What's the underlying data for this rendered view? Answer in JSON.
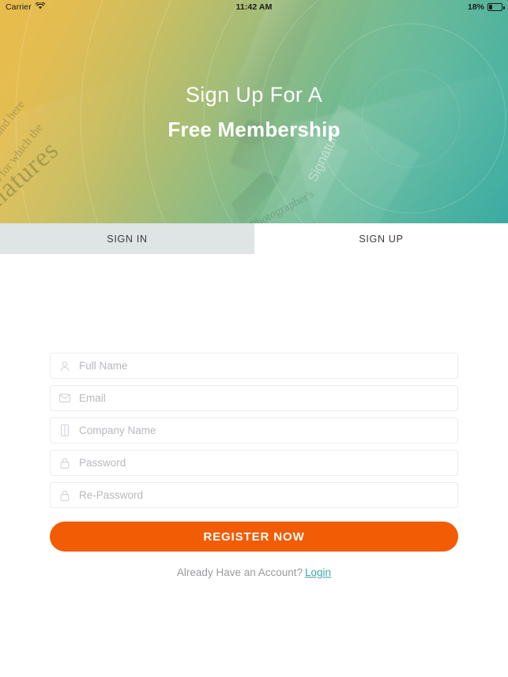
{
  "status_bar": {
    "carrier": "Carrier",
    "wifi_icon": "wifi-icon",
    "time": "11:42 AM",
    "battery_percent": "18%",
    "battery_icon": "battery-low-icon"
  },
  "hero": {
    "title_line1": "Sign Up For A",
    "title_line2": "Free Membership",
    "background_image": "fountain-pen-signature-document-photo",
    "gradient_start": "#e9bc4b",
    "gradient_mid": "#86bb88",
    "gradient_end": "#3aa9a2",
    "watermarks": {
      "signatures": "natures",
      "line1": "phs , and here",
      "line2": "phs for which the",
      "signature_right": "Signature",
      "photographer": "Photographer's"
    }
  },
  "tabs": {
    "sign_in": "SIGN IN",
    "sign_up": "SIGN UP",
    "active": "SIGN UP",
    "inactive_bg": "#dfe4e4"
  },
  "form": {
    "fields": [
      {
        "name": "full-name",
        "icon": "user-icon",
        "placeholder": "Full Name",
        "value": ""
      },
      {
        "name": "email",
        "icon": "mail-icon",
        "placeholder": "Email",
        "value": ""
      },
      {
        "name": "company-name",
        "icon": "building-icon",
        "placeholder": "Company Name",
        "value": ""
      },
      {
        "name": "password",
        "icon": "lock-icon",
        "placeholder": "Password",
        "value": ""
      },
      {
        "name": "re-password",
        "icon": "lock-icon",
        "placeholder": "Re-Password",
        "value": ""
      }
    ],
    "submit_label": "REGISTER NOW",
    "submit_color": "#f25c05"
  },
  "footer": {
    "prompt": "Already Have an Account?",
    "link": "Login",
    "link_color": "#3fa8a8"
  }
}
